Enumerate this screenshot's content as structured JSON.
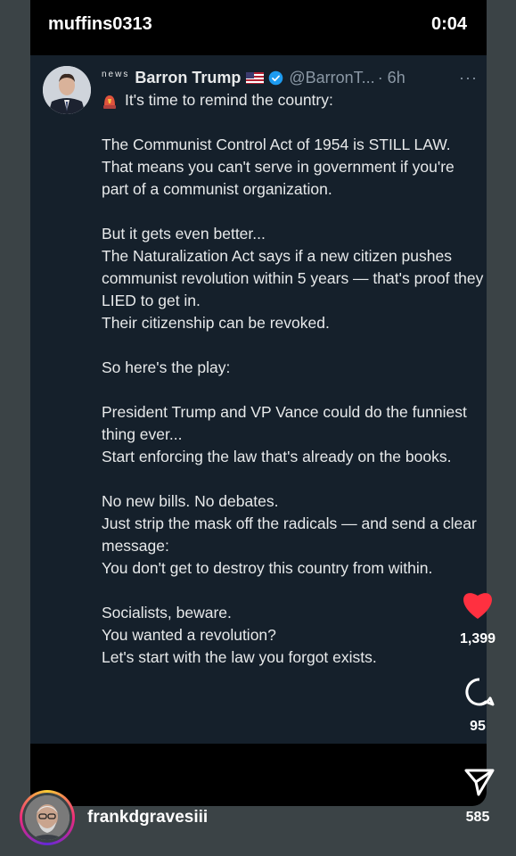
{
  "story": {
    "username": "muffins0313",
    "timer": "0:04"
  },
  "tweet": {
    "news_label": "news",
    "display_name": "Barron Trump",
    "handle": "@BarronT...",
    "time_ago": "· 6h",
    "more": "···",
    "first_line": "It's time to remind the country:",
    "lines": [
      "",
      "The Communist Control Act of 1954 is STILL LAW.",
      "That means you can't serve in government if you're part of a communist organization.",
      "",
      "But it gets even better...",
      "The Naturalization Act says if a new citizen pushes communist revolution within 5 years — that's proof they LIED to get in.",
      "Their citizenship can be revoked.",
      "",
      "So here's the play:",
      "",
      "President Trump and VP Vance could do the funniest thing ever...",
      "Start enforcing the law that's already on the books.",
      "",
      "No new bills. No debates.",
      "Just strip the mask off the radicals — and send a clear message:",
      "You don't get to destroy this country from within.",
      "",
      "Socialists, beware.",
      "You wanted a revolution?",
      "Let's start with the law you forgot exists."
    ]
  },
  "actions": {
    "likes": "1,399",
    "comments": "95",
    "shares": "585"
  },
  "owner": {
    "username": "frankdgravesiii"
  },
  "colors": {
    "like": "#ff3040",
    "verified": "#1d9bf0",
    "post_bg": "#15202b",
    "page_bg": "#3b4346"
  }
}
